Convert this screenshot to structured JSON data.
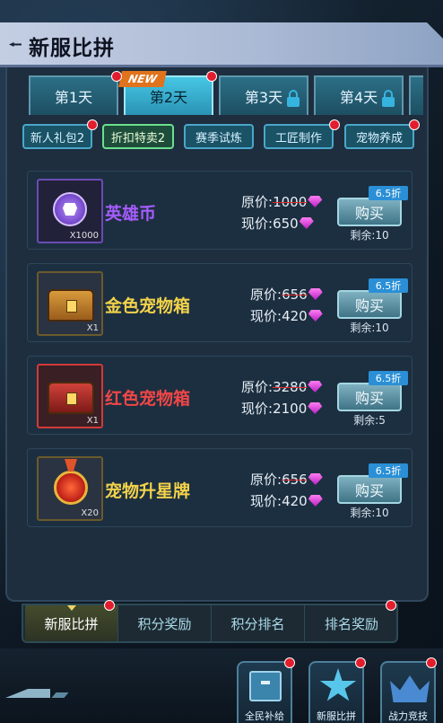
{
  "header": {
    "title": "新服比拼"
  },
  "new_badge": "NEW",
  "day_tabs": [
    {
      "label": "第1天",
      "active": false,
      "locked": false
    },
    {
      "label": "第2天",
      "active": true,
      "locked": false
    },
    {
      "label": "第3天",
      "active": false,
      "locked": true
    },
    {
      "label": "第4天",
      "active": false,
      "locked": true
    }
  ],
  "sub_tabs": [
    {
      "label": "新人礼包2",
      "active": false
    },
    {
      "label": "折扣特卖2",
      "active": true
    },
    {
      "label": "赛季试炼",
      "active": false
    },
    {
      "label": "工匠制作",
      "active": false
    },
    {
      "label": "宠物养成",
      "active": false
    }
  ],
  "items": [
    {
      "name": "英雄币",
      "name_color": "#a65cff",
      "qty": "X1000",
      "icon": "hero-coin-icon",
      "orig_label": "原价:",
      "orig_price": "1000",
      "now_label": "现价:",
      "now_price": "650",
      "discount": "6.5折",
      "buy": "购买",
      "remain": "剩余:10"
    },
    {
      "name": "金色宠物箱",
      "name_color": "#f2d24a",
      "qty": "X1",
      "icon": "gold-pet-chest-icon",
      "orig_label": "原价:",
      "orig_price": "656",
      "now_label": "现价:",
      "now_price": "420",
      "discount": "6.5折",
      "buy": "购买",
      "remain": "剩余:10"
    },
    {
      "name": "红色宠物箱",
      "name_color": "#f04646",
      "qty": "X1",
      "icon": "red-pet-chest-icon",
      "orig_label": "原价:",
      "orig_price": "3280",
      "now_label": "现价:",
      "now_price": "2100",
      "discount": "6.5折",
      "buy": "购买",
      "remain": "剩余:5"
    },
    {
      "name": "宠物升星牌",
      "name_color": "#f2d24a",
      "qty": "X20",
      "icon": "pet-star-medal-icon",
      "orig_label": "原价:",
      "orig_price": "656",
      "now_label": "现价:",
      "now_price": "420",
      "discount": "6.5折",
      "buy": "购买",
      "remain": "剩余:10"
    }
  ],
  "bottom_tabs": [
    {
      "label": "新服比拼",
      "active": true
    },
    {
      "label": "积分奖励",
      "active": false
    },
    {
      "label": "积分排名",
      "active": false
    },
    {
      "label": "排名奖励",
      "active": false
    }
  ],
  "footer_buttons": [
    {
      "label": "全民补给",
      "icon": "supply-box-icon"
    },
    {
      "label": "新服比拼",
      "icon": "star-icon"
    },
    {
      "label": "战力竞技",
      "icon": "crown-icon"
    }
  ],
  "colors": {
    "accent": "#47c6e4",
    "badge_red": "#e21d2d",
    "gem": "#e04be8"
  }
}
